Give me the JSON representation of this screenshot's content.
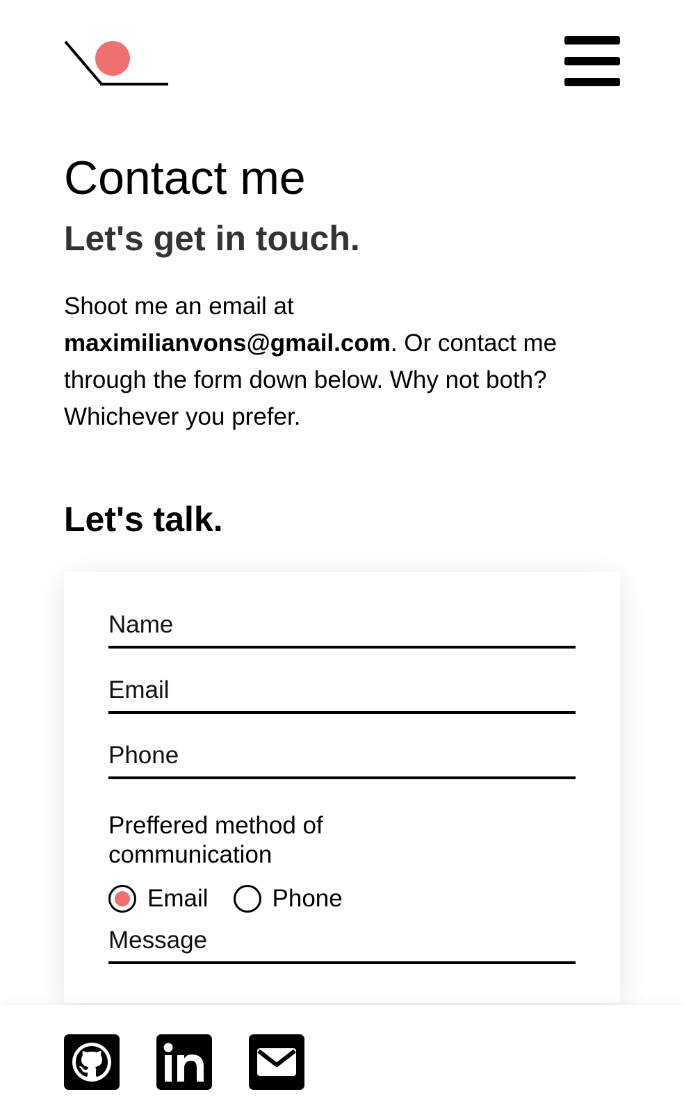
{
  "header": {
    "logo_accent_color": "#f07070",
    "menu_icon": "hamburger-menu-icon"
  },
  "intro": {
    "title": "Contact me",
    "subtitle": "Let's get in touch.",
    "text_before": "Shoot me an email at ",
    "email": "maximilianvons@gmail.com",
    "text_after": ". Or contact me through the form down below. Why not both? Whichever you prefer."
  },
  "form": {
    "heading": "Let's talk.",
    "name_placeholder": "Name",
    "email_placeholder": "Email",
    "phone_placeholder": "Phone",
    "preferred_label": "Preffered method of communication",
    "options": [
      {
        "label": "Email",
        "checked": true
      },
      {
        "label": "Phone",
        "checked": false
      }
    ],
    "message_placeholder": "Message",
    "accent_color": "#f07070"
  },
  "footer": {
    "links": [
      {
        "icon": "github-icon"
      },
      {
        "icon": "linkedin-icon"
      },
      {
        "icon": "email-icon"
      }
    ]
  }
}
